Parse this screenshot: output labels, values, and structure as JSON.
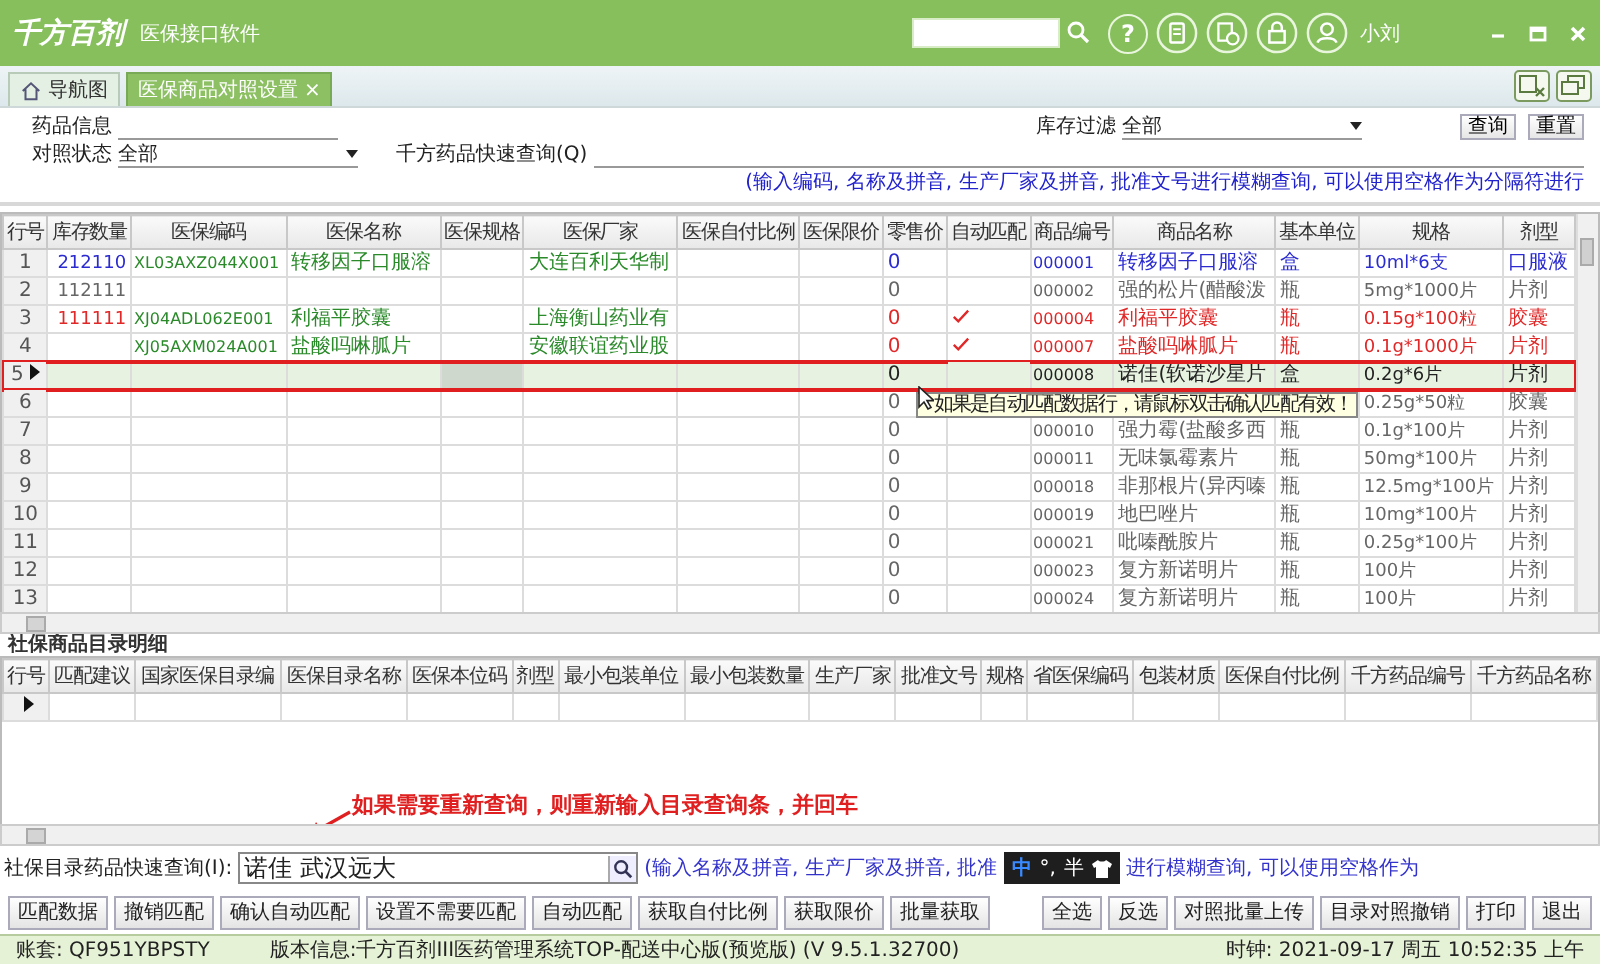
{
  "app": {
    "logo": "千方百剂",
    "title": "医保接口软件",
    "help_glyph": "?",
    "user": "小刘"
  },
  "tabs": [
    {
      "label": "导航图",
      "selected": false,
      "kind": "home"
    },
    {
      "label": "医保商品对照设置",
      "selected": true,
      "kind": "closable",
      "close": "×"
    }
  ],
  "filters": {
    "drug_info_label": "药品信息",
    "status_label": "对照状态",
    "status_value": "全部",
    "quick_label": "千方药品快速查询(Q)",
    "stock_label": "库存过滤",
    "stock_value": "全部",
    "hint": "(输入编码, 名称及拼音, 生产厂家及拼音, 批准文号进行模糊查询, 可以使用空格作为分隔符进行"
  },
  "filter_buttons": [
    "查询",
    "重置"
  ],
  "table": {
    "columns": [
      "行号",
      "库存数量",
      "医保编码",
      "医保名称",
      "医保规格",
      "医保厂家",
      "医保自付比例",
      "医保限价",
      "零售价",
      "自动匹配",
      "商品编号",
      "商品名称",
      "基本单位",
      "规格",
      "剂型"
    ],
    "rows": [
      {
        "no": "1",
        "stock": "212110",
        "code": "XL03AXZ044X001",
        "name": "转移因子口服溶",
        "maker": "大连百利天华制",
        "retail": "0",
        "auto_match": false,
        "sku": "000001",
        "product": "转移因子口服溶",
        "unit": "盒",
        "size": "10ml*6支",
        "form": "口服液",
        "color": "#2b2bd0",
        "selected": false,
        "highlighted": false
      },
      {
        "no": "2",
        "stock": "112111",
        "retail": "0",
        "auto_match": false,
        "sku": "000002",
        "product": "强的松片(醋酸泼",
        "unit": "瓶",
        "size": "5mg*1000片",
        "form": "片剂",
        "color": "#666666",
        "selected": false,
        "highlighted": false
      },
      {
        "no": "3",
        "stock": "111111",
        "code": "XJ04ADL062E001",
        "name": "利福平胶囊",
        "maker": "上海衡山药业有",
        "retail": "0",
        "auto_match": true,
        "sku": "000004",
        "product": "利福平胶囊",
        "unit": "瓶",
        "size": "0.15g*100粒",
        "form": "胶囊",
        "color": "#e02828",
        "selected": false,
        "highlighted": false
      },
      {
        "no": "4",
        "code": "XJ05AXM024A001",
        "name": "盐酸吗啉胍片",
        "maker": "安徽联谊药业股",
        "retail": "0",
        "auto_match": true,
        "sku": "000007",
        "product": "盐酸吗啉胍片",
        "unit": "瓶",
        "size": "0.1g*1000片",
        "form": "片剂",
        "color": "#e02828",
        "selected": false,
        "highlighted": false
      },
      {
        "no": "5",
        "retail": "0",
        "auto_match": false,
        "sku": "000008",
        "product": "诺佳(软诺沙星片",
        "unit": "盒",
        "size": "0.2g*6片",
        "form": "片剂",
        "color": "#222222",
        "selected": true,
        "highlighted": true
      },
      {
        "no": "6",
        "retail": "0",
        "auto_match": false,
        "size": "0.25g*50粒",
        "form": "胶囊",
        "color": "#666666",
        "selected": false,
        "highlighted": false
      },
      {
        "no": "7",
        "retail": "0",
        "auto_match": false,
        "sku": "000010",
        "product": "强力霉(盐酸多西",
        "unit": "瓶",
        "size": "0.1g*100片",
        "form": "片剂",
        "color": "#666666",
        "selected": false,
        "highlighted": false
      },
      {
        "no": "8",
        "retail": "0",
        "auto_match": false,
        "sku": "000011",
        "product": "无味氯霉素片",
        "unit": "瓶",
        "size": "50mg*100片",
        "form": "片剂",
        "color": "#666666",
        "selected": false,
        "highlighted": false
      },
      {
        "no": "9",
        "retail": "0",
        "auto_match": false,
        "sku": "000018",
        "product": "非那根片(异丙嗪",
        "unit": "瓶",
        "size": "12.5mg*100片",
        "form": "片剂",
        "color": "#666666",
        "selected": false,
        "highlighted": false
      },
      {
        "no": "10",
        "retail": "0",
        "auto_match": false,
        "sku": "000019",
        "product": "地巴唑片",
        "unit": "瓶",
        "size": "10mg*100片",
        "form": "片剂",
        "color": "#666666",
        "selected": false,
        "highlighted": false
      },
      {
        "no": "11",
        "retail": "0",
        "auto_match": false,
        "sku": "000021",
        "product": "吡嗪酰胺片",
        "unit": "瓶",
        "size": "0.25g*100片",
        "form": "片剂",
        "color": "#666666",
        "selected": false,
        "highlighted": false
      },
      {
        "no": "12",
        "retail": "0",
        "auto_match": false,
        "sku": "000023",
        "product": "复方新诺明片",
        "unit": "瓶",
        "size": "100片",
        "form": "片剂",
        "color": "#666666",
        "selected": false,
        "highlighted": false
      },
      {
        "no": "13",
        "retail": "0",
        "auto_match": false,
        "sku": "000024",
        "product": "复方新诺明片",
        "unit": "瓶",
        "size": "100片",
        "form": "片剂",
        "color": "#666666",
        "selected": false,
        "highlighted": false
      }
    ]
  },
  "tooltip": "如果是自动匹配数据行，请鼠标双击确认匹配有效！",
  "detail": {
    "title": "社保商品目录明细",
    "columns": [
      "行号",
      "匹配建议",
      "国家医保目录编",
      "医保目录名称",
      "医保本位码",
      "剂型",
      "最小包装单位",
      "最小包装数量",
      "生产厂家",
      "批准文号",
      "规格",
      "省医保编码",
      "包装材质",
      "医保自付比例",
      "千方药品编号",
      "千方药品名称"
    ]
  },
  "annotation": "如果需要重新查询，则重新输入目录查询条，并回车",
  "catalog_search": {
    "label": "社保目录药品快速查询(I):",
    "value": "诺佳 武汉远大",
    "hint_before": "(输入名称及拼音, 生产厂家及拼音, 批准",
    "hint_after": "进行模糊查询, 可以使用空格作为"
  },
  "ime": {
    "mode": "中",
    "punct": "°,",
    "width": "半"
  },
  "actions_left": [
    "匹配数据",
    "撤销匹配",
    "确认自动匹配",
    "设置不需要匹配",
    "自动匹配",
    "获取自付比例",
    "获取限价",
    "批量获取"
  ],
  "actions_right": [
    "全选",
    "反选",
    "对照批量上传",
    "目录对照撤销",
    "打印",
    "退出"
  ],
  "status_bar": {
    "account": "账套: QF951YBPSTY",
    "version": "版本信息:千方百剂III医药管理系统TOP-配送中心版(预览版) (V 9.5.1.32700)",
    "clock": "时钟: 2021-09-17 周五 10:52:35 上午"
  }
}
